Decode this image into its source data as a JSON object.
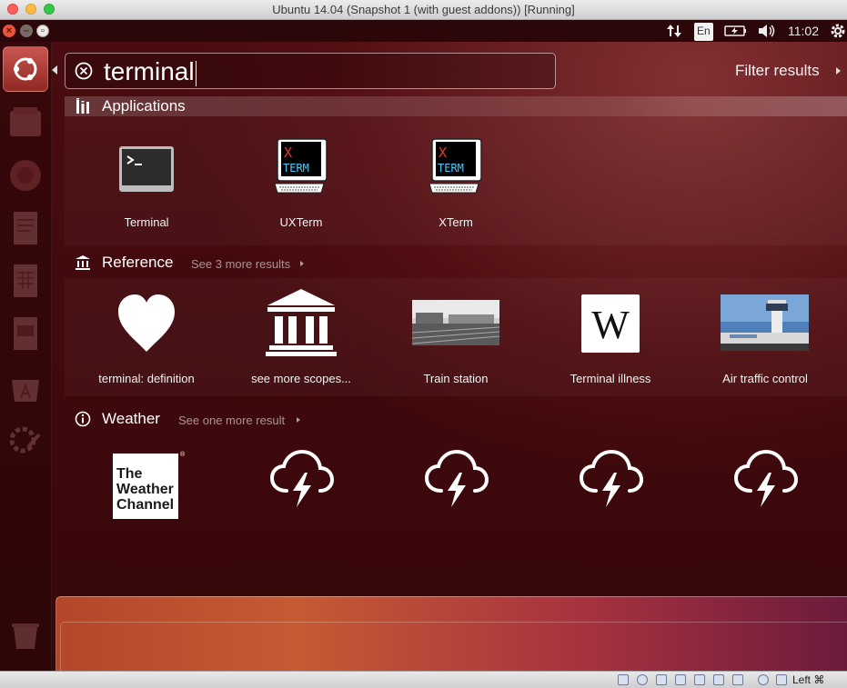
{
  "window": {
    "title": "Ubuntu 14.04 (Snapshot 1 (with guest addons)) [Running]"
  },
  "panel": {
    "keyboard_layout": "En",
    "time": "11:02"
  },
  "search": {
    "query": "terminal"
  },
  "filter_label": "Filter results",
  "applications": {
    "title": "Applications",
    "items": [
      {
        "label": "Terminal",
        "icon": "terminal-icon"
      },
      {
        "label": "UXTerm",
        "icon": "xterm-icon"
      },
      {
        "label": "XTerm",
        "icon": "xterm-icon"
      }
    ]
  },
  "reference": {
    "title": "Reference",
    "more": "See 3 more results",
    "items": [
      {
        "label": "terminal: definition",
        "icon": "heart-icon"
      },
      {
        "label": "see more scopes...",
        "icon": "building-icon"
      },
      {
        "label": "Train station",
        "icon": "train-station-photo"
      },
      {
        "label": "Terminal illness",
        "icon": "wikipedia-icon"
      },
      {
        "label": "Air traffic control",
        "icon": "airport-tower-photo"
      }
    ]
  },
  "weather": {
    "title": "Weather",
    "more": "See one more result",
    "logo": {
      "line1": "The",
      "line2": "Weather",
      "line3": "Channel"
    },
    "items": [
      "thunderstorm-icon",
      "thunderstorm-icon",
      "thunderstorm-icon",
      "thunderstorm-icon"
    ]
  },
  "xterm_glyph": {
    "x": "X",
    "term": "TERM"
  },
  "wiki_glyph": "W",
  "vbox": {
    "host_key": "Left ⌘"
  },
  "colors": {
    "accent": "#dd4814",
    "dash_bg": "#4a0c10"
  }
}
